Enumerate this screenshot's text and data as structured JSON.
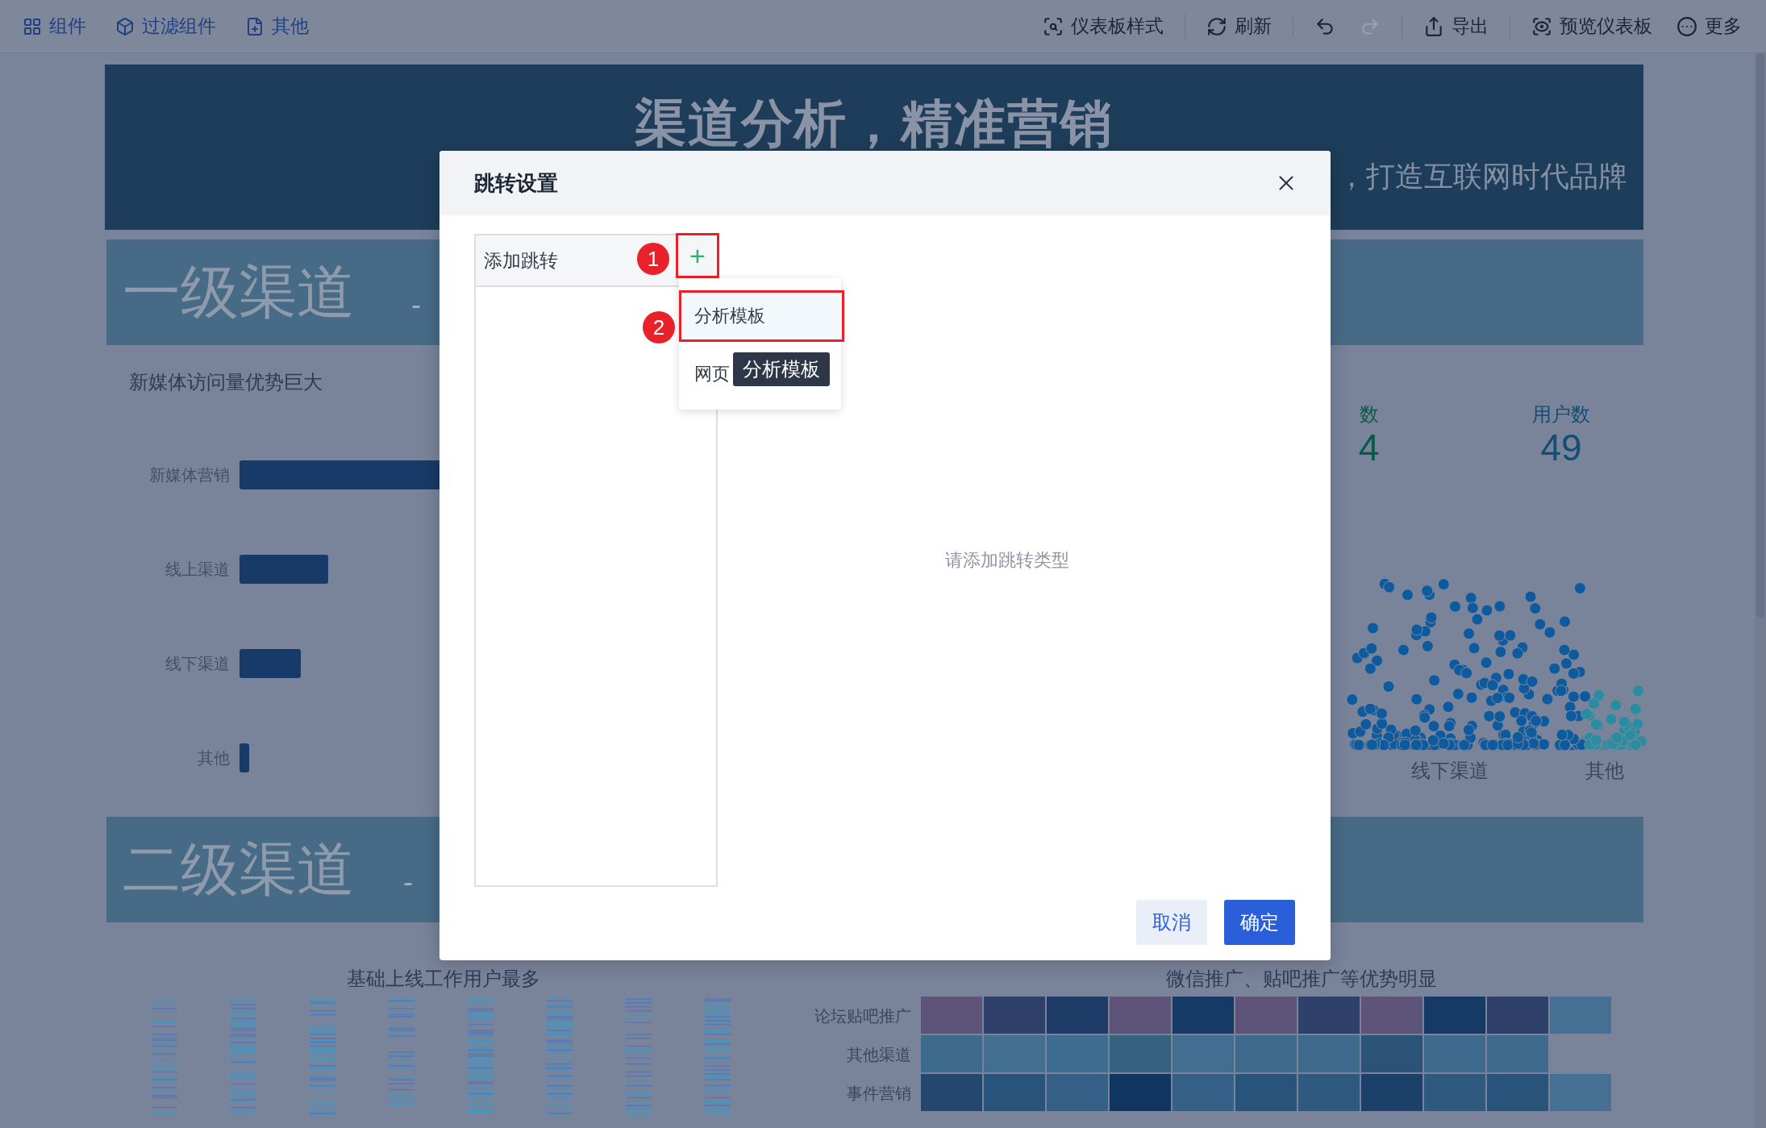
{
  "toolbar": {
    "left": [
      {
        "label": "组件"
      },
      {
        "label": "过滤组件"
      },
      {
        "label": "其他"
      }
    ],
    "right_groups": [
      [
        {
          "kind": "labeled",
          "label": "仪表板样式",
          "disabled": false
        }
      ],
      [
        {
          "kind": "labeled",
          "label": "刷新",
          "disabled": false
        }
      ],
      [
        {
          "kind": "icon",
          "disabled": false
        },
        {
          "kind": "icon",
          "disabled": true
        }
      ],
      [
        {
          "kind": "labeled",
          "label": "导出",
          "disabled": false
        }
      ],
      [
        {
          "kind": "labeled",
          "label": "预览仪表板",
          "disabled": false
        },
        {
          "kind": "labeled",
          "label": "更多",
          "disabled": false
        }
      ]
    ]
  },
  "dashboard": {
    "banner": {
      "title": "渠道分析，精准营销",
      "subtitle": "，打造互联网时代品牌"
    },
    "sections": [
      {
        "title": "一级渠道",
        "subtitle": "-"
      },
      {
        "title": "二级渠道",
        "subtitle": "-"
      }
    ],
    "channel_chart": {
      "title": "新媒体访问量优势巨大",
      "categories": [
        "新媒体营销",
        "线上渠道",
        "线下渠道",
        "其他"
      ]
    },
    "metrics": [
      {
        "label": "数",
        "value": "4",
        "color": "#0a5a48"
      },
      {
        "label": "用户数",
        "value": "49",
        "color": "#134f74"
      }
    ],
    "scatter_labels": [
      "线下渠道",
      "其他"
    ],
    "stripe_chart": {
      "title": "基础上线工作用户最多"
    },
    "heatmap": {
      "title": "微信推广、贴吧推广等优势明显",
      "rows": [
        "论坛贴吧推广",
        "其他渠道",
        "事件营销"
      ]
    }
  },
  "dialog": {
    "title": "跳转设置",
    "panel": {
      "header": "添加跳转",
      "add_button": {
        "label": "+",
        "marked": true,
        "callout": "1"
      }
    },
    "menu": [
      {
        "label": "分析模板",
        "selected": true,
        "marked": true,
        "callout": "2"
      },
      {
        "label": "网页",
        "selected": false,
        "marked": false
      }
    ],
    "tooltip": "分析模板",
    "empty_text": "请添加跳转类型",
    "buttons": [
      {
        "label": "取消",
        "kind": "secondary"
      },
      {
        "label": "确定",
        "kind": "primary"
      }
    ]
  }
}
